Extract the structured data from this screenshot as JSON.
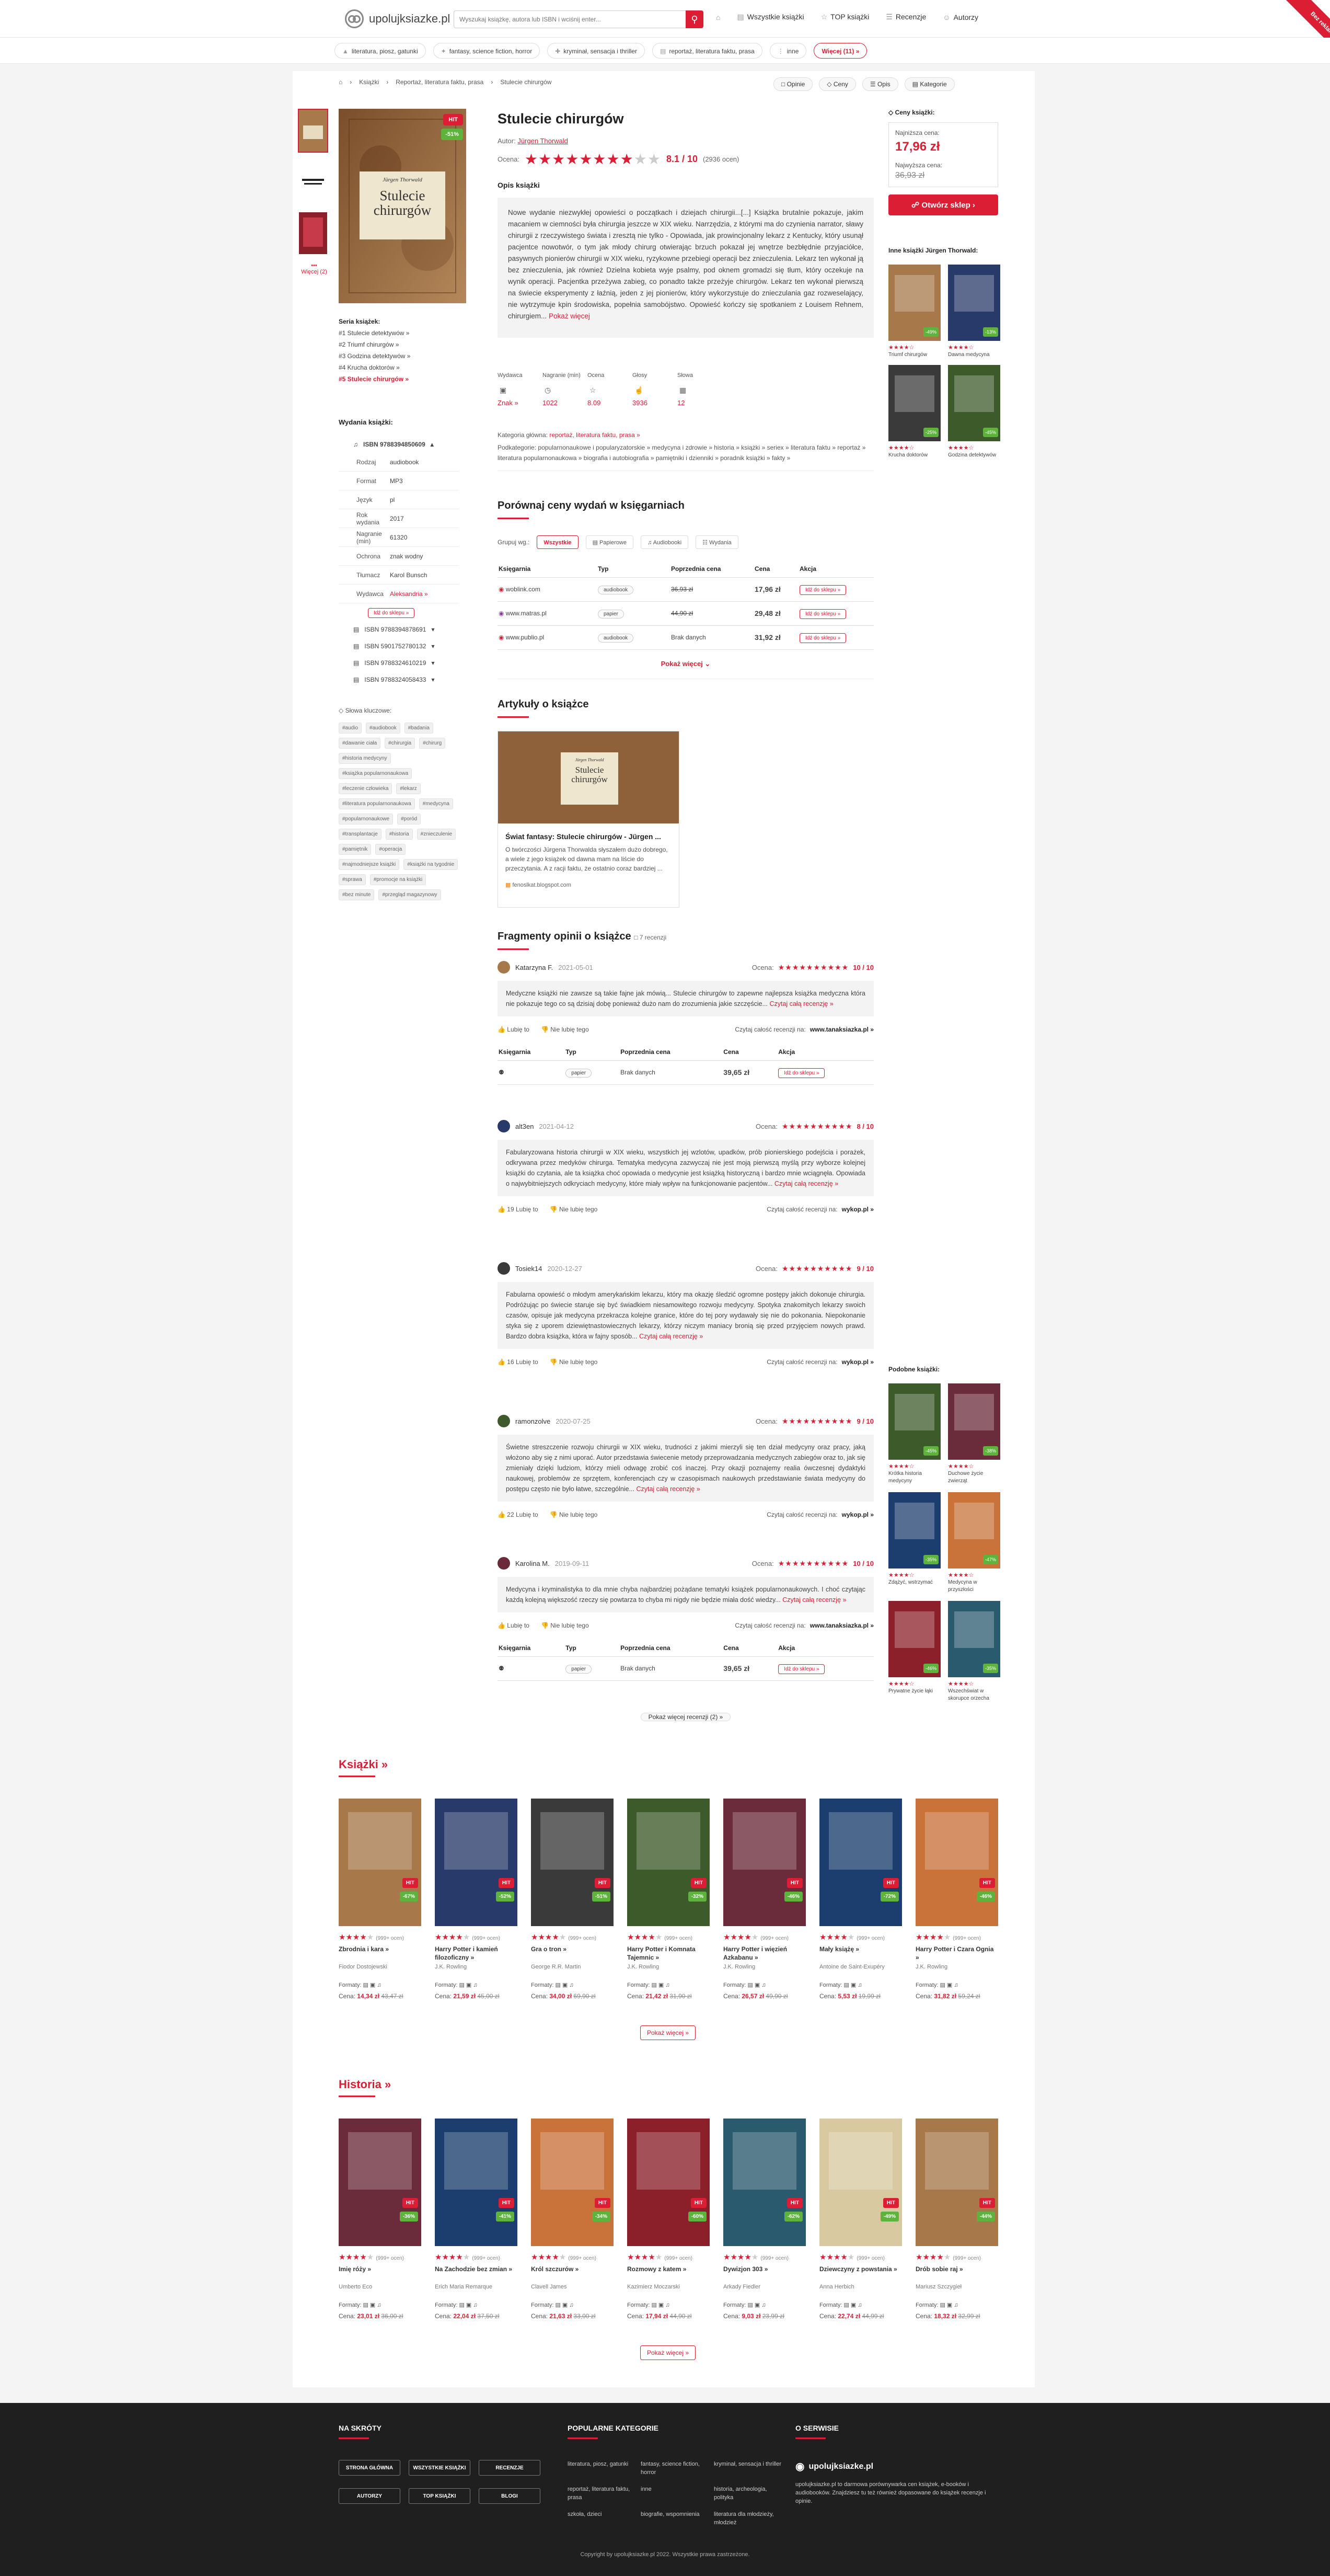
{
  "header": {
    "logo": "upolujksiazke.pl",
    "search_placeholder": "Wyszukaj książkę, autora lub ISBN i wciśnij enter...",
    "nav": [
      "Wszystkie książki",
      "TOP książki",
      "Recenzje",
      "Autorzy"
    ],
    "ribbon": "Bez reklam"
  },
  "subnav": [
    "literatura, piosz, gatunki",
    "fantasy, science fiction, horror",
    "kryminał, sensacja i thriller",
    "reportaż, literatura faktu, prasa",
    "inne",
    "Więcej (11) »"
  ],
  "breadcrumb": [
    "Książki",
    "Reportaż, literatura faktu, prasa",
    "Stulecie chirurgów"
  ],
  "crumb_buttons": [
    "Opinie",
    "Ceny",
    "Opis",
    "Kategorie"
  ],
  "book": {
    "title": "Stulecie chirurgów",
    "author_label": "Autor:",
    "author": "Jürgen Thorwald",
    "rating_label": "Ocena:",
    "rating": "8.1 / 10",
    "rating_count": "(2936 ocen)",
    "badge_hit": "HIT",
    "badge_pct": "-51%",
    "cover_title": "Stulecie chirurgów",
    "cover_author": "Jürgen Thorwald",
    "desc_title": "Opis książki",
    "description": "Nowe wydanie niezwykłej opowieści o początkach i dziejach chirurgii...[...] Książka brutalnie pokazuje, jakim macaniem w ciemności była chirurgia jeszcze w XIX wieku. Narrzędzia, z którymi ma do czynienia narrator, sławy chirurgii z rzeczywistego świata i zresztą nie tylko - Opowiada, jak prowincjonalny lekarz z Kentucky, który usunął pacjentce nowotwór, o tym jak młody chirurg otwierając brzuch pokazał jej wnętrze bezbłędnie przyjaciółce, pasywnych pionierów chirurgii w XIX wieku, ryzykowne przebiegi operacji bez znieczulenia. Lekarz ten wykonał ją bez znieczulenia, jak również Dzielna kobieta wyje psalmy, pod oknem gromadzi się tłum, który oczekuje na wynik operacji. Pacjentka przeżywa zabieg, co ponadto także przeżyje chirurgów. Lekarz ten wykonał pierwszą na świecie eksperymenty z łaźnią, jeden z jej pionierów, który wykorzystuje do znieczulania gaz rozweselający, nie wytrzymuje kpin środowiska, popełnia samobójstwo. Opowieść kończy się spotkaniem z Louisem Rehnem, chirurgiem...",
    "desc_more": "Pokaż więcej",
    "props": [
      {
        "label": "Wydawca",
        "value": "Znak »"
      },
      {
        "label": "Nagranie (min)",
        "value": "1022"
      },
      {
        "label": "Ocena",
        "value": "8.09"
      },
      {
        "label": "Głosy",
        "value": "3936"
      },
      {
        "label": "Słowa",
        "value": "12"
      }
    ],
    "category_label": "Kategoria główna:",
    "category": "reportaż, literatura faktu, prasa »",
    "subcategory_label": "Podkategorie:",
    "subcategories": "popularnonaukowe i popularyzatorskie » medycyna i zdrowie » historia » książki » seriex » literatura faktu » reportaż » literatura popularnonaukowa » biografia i autobiografia » pamiętniki i dzienniki » poradnik książki » fakty »"
  },
  "thumbs_more": "Więcej (2)",
  "series": {
    "title": "Seria książek:",
    "items": [
      "#1 Stulecie detektywów »",
      "#2 Triumf chirurgów »",
      "#3 Godzina detektywów »",
      "#4 Krucha doktorów »",
      "#5 Stulecie chirurgów »"
    ]
  },
  "editions": {
    "title": "Wydania książki:",
    "isbn_main": "ISBN 9788394850609",
    "rows": [
      {
        "k": "Rodzaj",
        "v": "audiobook"
      },
      {
        "k": "Format",
        "v": "MP3"
      },
      {
        "k": "Język",
        "v": "pl"
      },
      {
        "k": "Rok wydania",
        "v": "2017"
      },
      {
        "k": "Nagranie (min)",
        "v": "61320"
      },
      {
        "k": "Ochrona",
        "v": "znak wodny"
      },
      {
        "k": "Tłumacz",
        "v": "Karol Bunsch"
      },
      {
        "k": "Wydawca",
        "v": "Aleksandria »"
      }
    ],
    "button": "Idź do sklepu »",
    "isbns": [
      "ISBN 9788394878691",
      "ISBN 5901752780132",
      "ISBN 9788324610219",
      "ISBN 9788324058433"
    ]
  },
  "tags": {
    "title": "Słowa kluczowe:",
    "items": [
      "#audio",
      "#audiobook",
      "#badania",
      "#dawanie ciała",
      "#chirurgia",
      "#chirurg",
      "#historia medycyny",
      "#książka popularnonaukowa",
      "#leczenie człowieka",
      "#lekarz",
      "#literatura popularnonaukowa",
      "#medycyna",
      "#popularnonaukowe",
      "#poród",
      "#transplantacje",
      "#historia",
      "#znieczulenie",
      "#pamiętnik",
      "#operacja",
      "#najmodniejsze książki",
      "#książki na tygodnie",
      "#sprawa",
      "#promocje na książki",
      "#bez minute",
      "#przegląd magazynowy"
    ]
  },
  "prices": {
    "title": "Ceny książki:",
    "lowest_label": "Najniższa cena:",
    "lowest": "17,96 zł",
    "highest_label": "Najwyższa cena:",
    "highest": "36,93 zł",
    "button": "Otwórz sklep"
  },
  "other_books": {
    "title": "Inne książki Jürgen Thorwald:",
    "items": [
      {
        "t": "Triumf chirurgów",
        "pct": "-49%"
      },
      {
        "t": "Dawna medycyna",
        "pct": "-13%"
      },
      {
        "t": "Krucha doktorów",
        "pct": "-25%"
      },
      {
        "t": "Godzina detektywów",
        "pct": "-45%"
      }
    ]
  },
  "similar": {
    "title": "Podobne książki:",
    "items": [
      {
        "t": "Krótka historia medycyny",
        "pct": "-45%"
      },
      {
        "t": "Duchowe życie zwierząt",
        "pct": "-38%"
      },
      {
        "t": "Zdążyć, wstrzymać",
        "pct": "-35%"
      },
      {
        "t": "Medycyna w przyszłości",
        "pct": "-47%"
      },
      {
        "t": "Prywatne życie łąki",
        "pct": "-46%"
      },
      {
        "t": "Wszechświat w skorupce orzecha",
        "pct": "-35%"
      }
    ]
  },
  "compare": {
    "title": "Porównaj ceny wydań w księgarniach",
    "group_label": "Grupuj wg.:",
    "groups": [
      "Wszystkie",
      "Papierowe",
      "Audiobooki",
      "Wydania"
    ],
    "headers": [
      "Księgarnia",
      "Typ",
      "Poprzednia cena",
      "Cena",
      "Akcja"
    ],
    "rows": [
      {
        "shop": "woblink.com",
        "type": "audiobook",
        "prev": "36,93 zł",
        "price": "17,96 zł",
        "btn": "Idź do sklepu »"
      },
      {
        "shop": "www.matras.pl",
        "type": "papier",
        "prev": "44,90 zł",
        "price": "29,48 zł",
        "btn": "Idź do sklepu »"
      },
      {
        "shop": "www.publio.pl",
        "type": "audiobook",
        "prev": "Brak danych",
        "price": "31,92 zł",
        "btn": "Idź do sklepu »"
      }
    ],
    "more": "Pokaż więcej"
  },
  "articles": {
    "title": "Artykuły o książce",
    "card_title": "Świat fantasy: Stulecie chirurgów - Jürgen ...",
    "card_text": "O twórczości Jürgena Thorwalda słyszałem dużo dobrego, a wiele z jego książek od dawna mam na liście do przeczytania. A z racji faktu, że ostatnio coraz bardziej ...",
    "card_src": "fenoslkat.blogspot.com"
  },
  "opinions": {
    "title": "Fragmenty opinii o książce",
    "count": "7 recenzji",
    "score_label": "Ocena:",
    "items": [
      {
        "user": "Katarzyna F.",
        "date": "2021-05-01",
        "score": "10 / 10",
        "text": "Medyczne książki nie zawsze są takie fajne jak mówią... Stulecie chirurgów to zapewne najlepsza książka medyczna która nie pokazuje tego co są dzisiaj dobę ponieważ dużo nam do zrozumienia jakie szczęście...",
        "more": "Czytaj całą recenzję »",
        "like": "Lubię to",
        "dislike": "Nie lubię tego",
        "read": "Czytaj całość recenzji na:",
        "src": "www.tanaksiazka.pl »",
        "shop": {
          "type": "papier",
          "prev": "Brak danych",
          "price": "39,65 zł",
          "btn": "Idź do sklepu »"
        }
      },
      {
        "user": "alt3en",
        "date": "2021-04-12",
        "score": "8 / 10",
        "text": "Fabularyzowana historia chirurgii w XIX wieku, wszystkich jej wzlotów, upadków, prób pionierskiego podejścia i porażek, odkrywana przez medyków chirurga. Tematyka medycyna zazwyczaj nie jest moją pierwszą myślą przy wyborze kolejnej książki do czytania, ale ta książka choć opowiada o medycynie jest książką historyczną i bardzo mnie wciągnęła. Opowiada o najwybitniejszych odkryciach medycyny, które miały wpływ na funkcjonowanie pacjentów...",
        "more": "Czytaj całą recenzję »",
        "like": "19 Lubię to",
        "dislike": "Nie lubię tego",
        "read": "Czytaj całość recenzji na:",
        "src": "wykop.pl »"
      },
      {
        "user": "Tosiek14",
        "date": "2020-12-27",
        "score": "9 / 10",
        "text": "Fabularna opowieść o młodym amerykańskim lekarzu, który ma okazję śledzić ogromne postępy jakich dokonuje chirurgia. Podróżując po świecie staruje się być świadkiem niesamowitego rozwoju medycyny. Spotyka znakomitych lekarzy swoich czasów, opisuje jak medycyna przekracza kolejne granice, które do tej pory wydawały się nie do pokonania. Niepokonanie styka się z uporem dziewiętnastowiecznych lekarzy, którzy niczym maniacy bronią się przed przyjęciem nowych prawd. Bardzo dobra książka, która w fajny sposób...",
        "more": "Czytaj całą recenzję »",
        "like": "16 Lubię to",
        "dislike": "Nie lubię tego",
        "read": "Czytaj całość recenzji na:",
        "src": "wykop.pl »"
      },
      {
        "user": "ramonzolve",
        "date": "2020-07-25",
        "score": "9 / 10",
        "text": "Świetne streszczenie rozwoju chirurgii w XIX wieku, trudności z jakimi mierzyli się ten dział medycyny oraz pracy, jaką włożono aby się z nimi uporać. Autor przedstawia świecenie metody przeprowadzania medycznych zabiegów oraz to, jak się zmieniały dzięki ludziom, którzy mieli odwagę zrobić coś inaczej. Przy okazji poznajemy realia ówczesnej dydaktyki naukowej, problemów ze sprzętem, konferencjach czy w czasopismach naukowych przedstawianie świata medycyny do postępu często nie było łatwe, szczególnie...",
        "more": "Czytaj całą recenzję »",
        "like": "22 Lubię to",
        "dislike": "Nie lubię tego",
        "read": "Czytaj całość recenzji na:",
        "src": "wykop.pl »"
      },
      {
        "user": "Karolina M.",
        "date": "2019-09-11",
        "score": "10 / 10",
        "text": "Medycyna i kryminalistyka to dla mnie chyba najbardziej pożądane tematyki książek popularnonaukowych. I choć czytając każdą kolejną większość rzeczy się powtarza to chyba mi nigdy nie będzie miała dość wiedzy...",
        "more": "Czytaj całą recenzję »",
        "like": "Lubię to",
        "dislike": "Nie lubię tego",
        "read": "Czytaj całość recenzji na:",
        "src": "www.tanaksiazka.pl »",
        "shop": {
          "type": "papier",
          "prev": "Brak danych",
          "price": "39,65 zł",
          "btn": "Idź do sklepu »"
        }
      }
    ],
    "shop_headers": [
      "Księgarnia",
      "Typ",
      "Poprzednia cena",
      "Cena",
      "Akcja"
    ],
    "more": "Pokaż więcej recenzji (2) »"
  },
  "row_books": {
    "title": "Książki »",
    "more": "Pokaż więcej »",
    "items": [
      {
        "t": "Zbrodnia i kara »",
        "a": "Fiodor Dostojewski",
        "cnt": "(999+ ocen)",
        "price": "14,34 zł",
        "old": "43,47 zł",
        "pct": "-67%"
      },
      {
        "t": "Harry Potter i kamień filozoficzny »",
        "a": "J.K. Rowling",
        "cnt": "(999+ ocen)",
        "price": "21,59 zł",
        "old": "45,00 zł",
        "pct": "-52%"
      },
      {
        "t": "Gra o tron »",
        "a": "George R.R. Martin",
        "cnt": "(999+ ocen)",
        "price": "34,00 zł",
        "old": "69,90 zł",
        "pct": "-51%"
      },
      {
        "t": "Harry Potter i Komnata Tajemnic »",
        "a": "J.K. Rowling",
        "cnt": "(999+ ocen)",
        "price": "21,42 zł",
        "old": "31,90 zł",
        "pct": "-32%"
      },
      {
        "t": "Harry Potter i więzień Azkabanu »",
        "a": "J.K. Rowling",
        "cnt": "(999+ ocen)",
        "price": "26,57 zł",
        "old": "49,90 zł",
        "pct": "-46%"
      },
      {
        "t": "Mały książę »",
        "a": "Antoine de Saint-Exupéry",
        "cnt": "(999+ ocen)",
        "price": "5,53 zł",
        "old": "19,99 zł",
        "pct": "-72%"
      },
      {
        "t": "Harry Potter i Czara Ognia »",
        "a": "J.K. Rowling",
        "cnt": "(999+ ocen)",
        "price": "31,82 zł",
        "old": "59,24 zł",
        "pct": "-46%"
      }
    ]
  },
  "row_history": {
    "title": "Historia »",
    "more": "Pokaż więcej »",
    "items": [
      {
        "t": "Imię róży »",
        "a": "Umberto Eco",
        "cnt": "(999+ ocen)",
        "price": "23,01 zł",
        "old": "36,00 zł",
        "pct": "-36%"
      },
      {
        "t": "Na Zachodzie bez zmian »",
        "a": "Erich Maria Remarque",
        "cnt": "(999+ ocen)",
        "price": "22,04 zł",
        "old": "37,50 zł",
        "pct": "-41%"
      },
      {
        "t": "Król szczurów »",
        "a": "Clavell James",
        "cnt": "(999+ ocen)",
        "price": "21,63 zł",
        "old": "33,00 zł",
        "pct": "-34%"
      },
      {
        "t": "Rozmowy z katem »",
        "a": "Kazimierz Moczarski",
        "cnt": "(999+ ocen)",
        "price": "17,94 zł",
        "old": "44,90 zł",
        "pct": "-60%"
      },
      {
        "t": "Dywizjon 303 »",
        "a": "Arkady Fiedler",
        "cnt": "(999+ ocen)",
        "price": "9,03 zł",
        "old": "23,99 zł",
        "pct": "-62%"
      },
      {
        "t": "Dziewczyny z powstania »",
        "a": "Anna Herbich",
        "cnt": "(999+ ocen)",
        "price": "22,74 zł",
        "old": "44,99 zł",
        "pct": "-49%"
      },
      {
        "t": "Drób sobie raj »",
        "a": "Mariusz Szczygieł",
        "cnt": "(999+ ocen)",
        "price": "18,32 zł",
        "old": "32,99 zł",
        "pct": "-44%"
      }
    ]
  },
  "formats_label": "Formaty:",
  "price_label": "Cena:",
  "footer": {
    "c1_title": "NA SKRÓTY",
    "buttons": [
      "STRONA GŁÓWNA",
      "WSZYSTKIE KSIĄŻKI",
      "RECENZJE",
      "AUTORZY",
      "TOP KSIĄŻKI",
      "BLOGI"
    ],
    "c2_title": "POPULARNE KATEGORIE",
    "cats": [
      "literatura, piosz, gatunki",
      "fantasy, science fiction, horror",
      "kryminał, sensacja i thriller",
      "reportaż, literatura faktu, prasa",
      "inne",
      "historia, archeologia, polityka",
      "szkoła, dzieci",
      "biografie, wspomnienia",
      "literatura dla młodzieży, młodzież"
    ],
    "c3_title": "O SERWISIE",
    "about_logo": "upolujksiazke.pl",
    "about": "upolujksiazke.pl to darmowa porównywarka cen książek, e-booków i audiobooków. Znajdziesz tu też również dopasowane do książek recenzje i opinie.",
    "copyright": "Copyright by upolujksiazke.pl 2022. Wszystkie prawa zastrzeżone."
  },
  "colors": {
    "accent": "#dc1e35",
    "green": "#5db33b",
    "footer": "#1f1f1f"
  }
}
